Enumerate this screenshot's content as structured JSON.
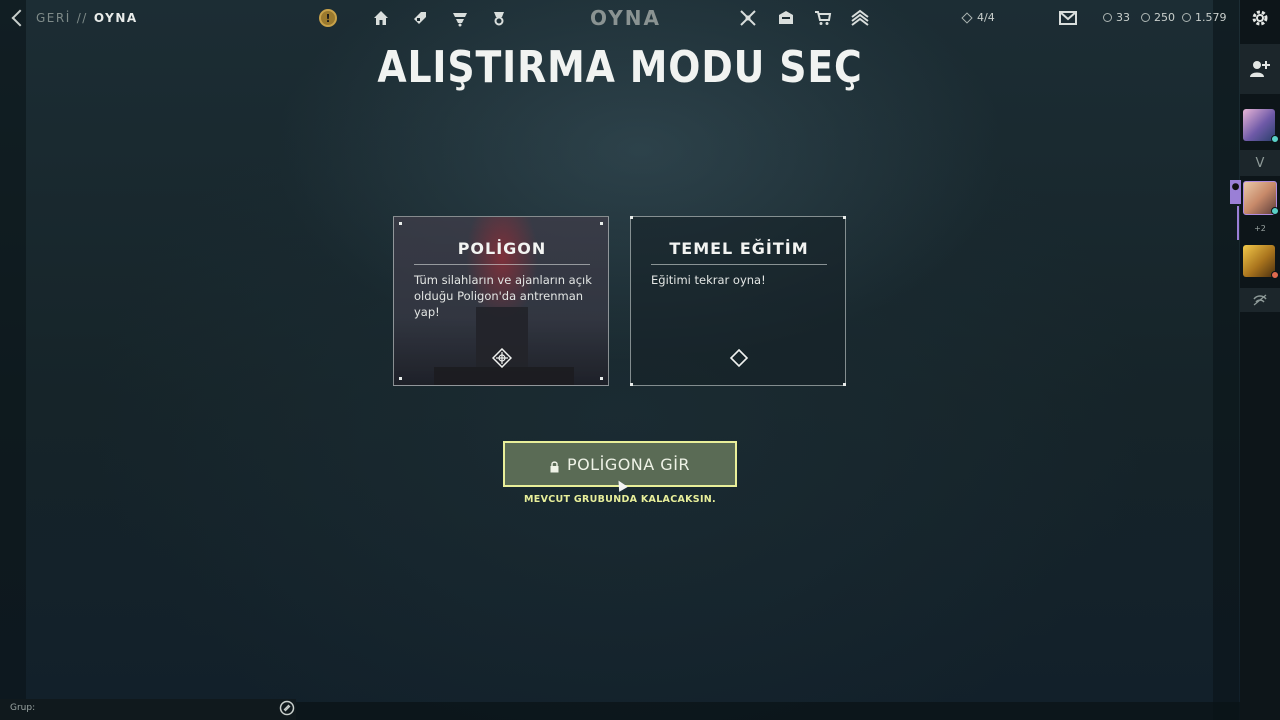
{
  "nav": {
    "back_label": "GERİ",
    "separator": "//",
    "current": "OYNA",
    "center_title": "OYNA",
    "icons_left": [
      "alert-icon",
      "home-icon",
      "agents-icon",
      "career-icon",
      "collection-icon"
    ],
    "icons_right": [
      "esports-icon",
      "battlepass-icon",
      "store-icon",
      "rank-icon"
    ],
    "party_count": "4/4",
    "kingdom_credits": "33",
    "radianite": "250",
    "valorant_points": "1.579"
  },
  "page": {
    "heading": "ALIŞTIRMA MODU SEÇ"
  },
  "cards": [
    {
      "title": "POLİGON",
      "description": "Tüm silahların ve ajanların açık olduğu Poligon'da antrenman yap!",
      "icon": "crosshair-icon",
      "selected": true
    },
    {
      "title": "TEMEL EĞİTİM",
      "description": "Eğitimi tekrar oyna!",
      "icon": "diamond-icon",
      "selected": false
    }
  ],
  "enter": {
    "button_label": "POLİGONA GİR",
    "note": "MEVCUT GRUBUNDA KALACAKSIN."
  },
  "social": {
    "extra_count": "+2"
  },
  "chat": {
    "group_label": "Grup:"
  },
  "colors": {
    "accent": "#e9ef9a",
    "button_bg": "#5a6b55",
    "party_purple": "#9a7fd6"
  }
}
